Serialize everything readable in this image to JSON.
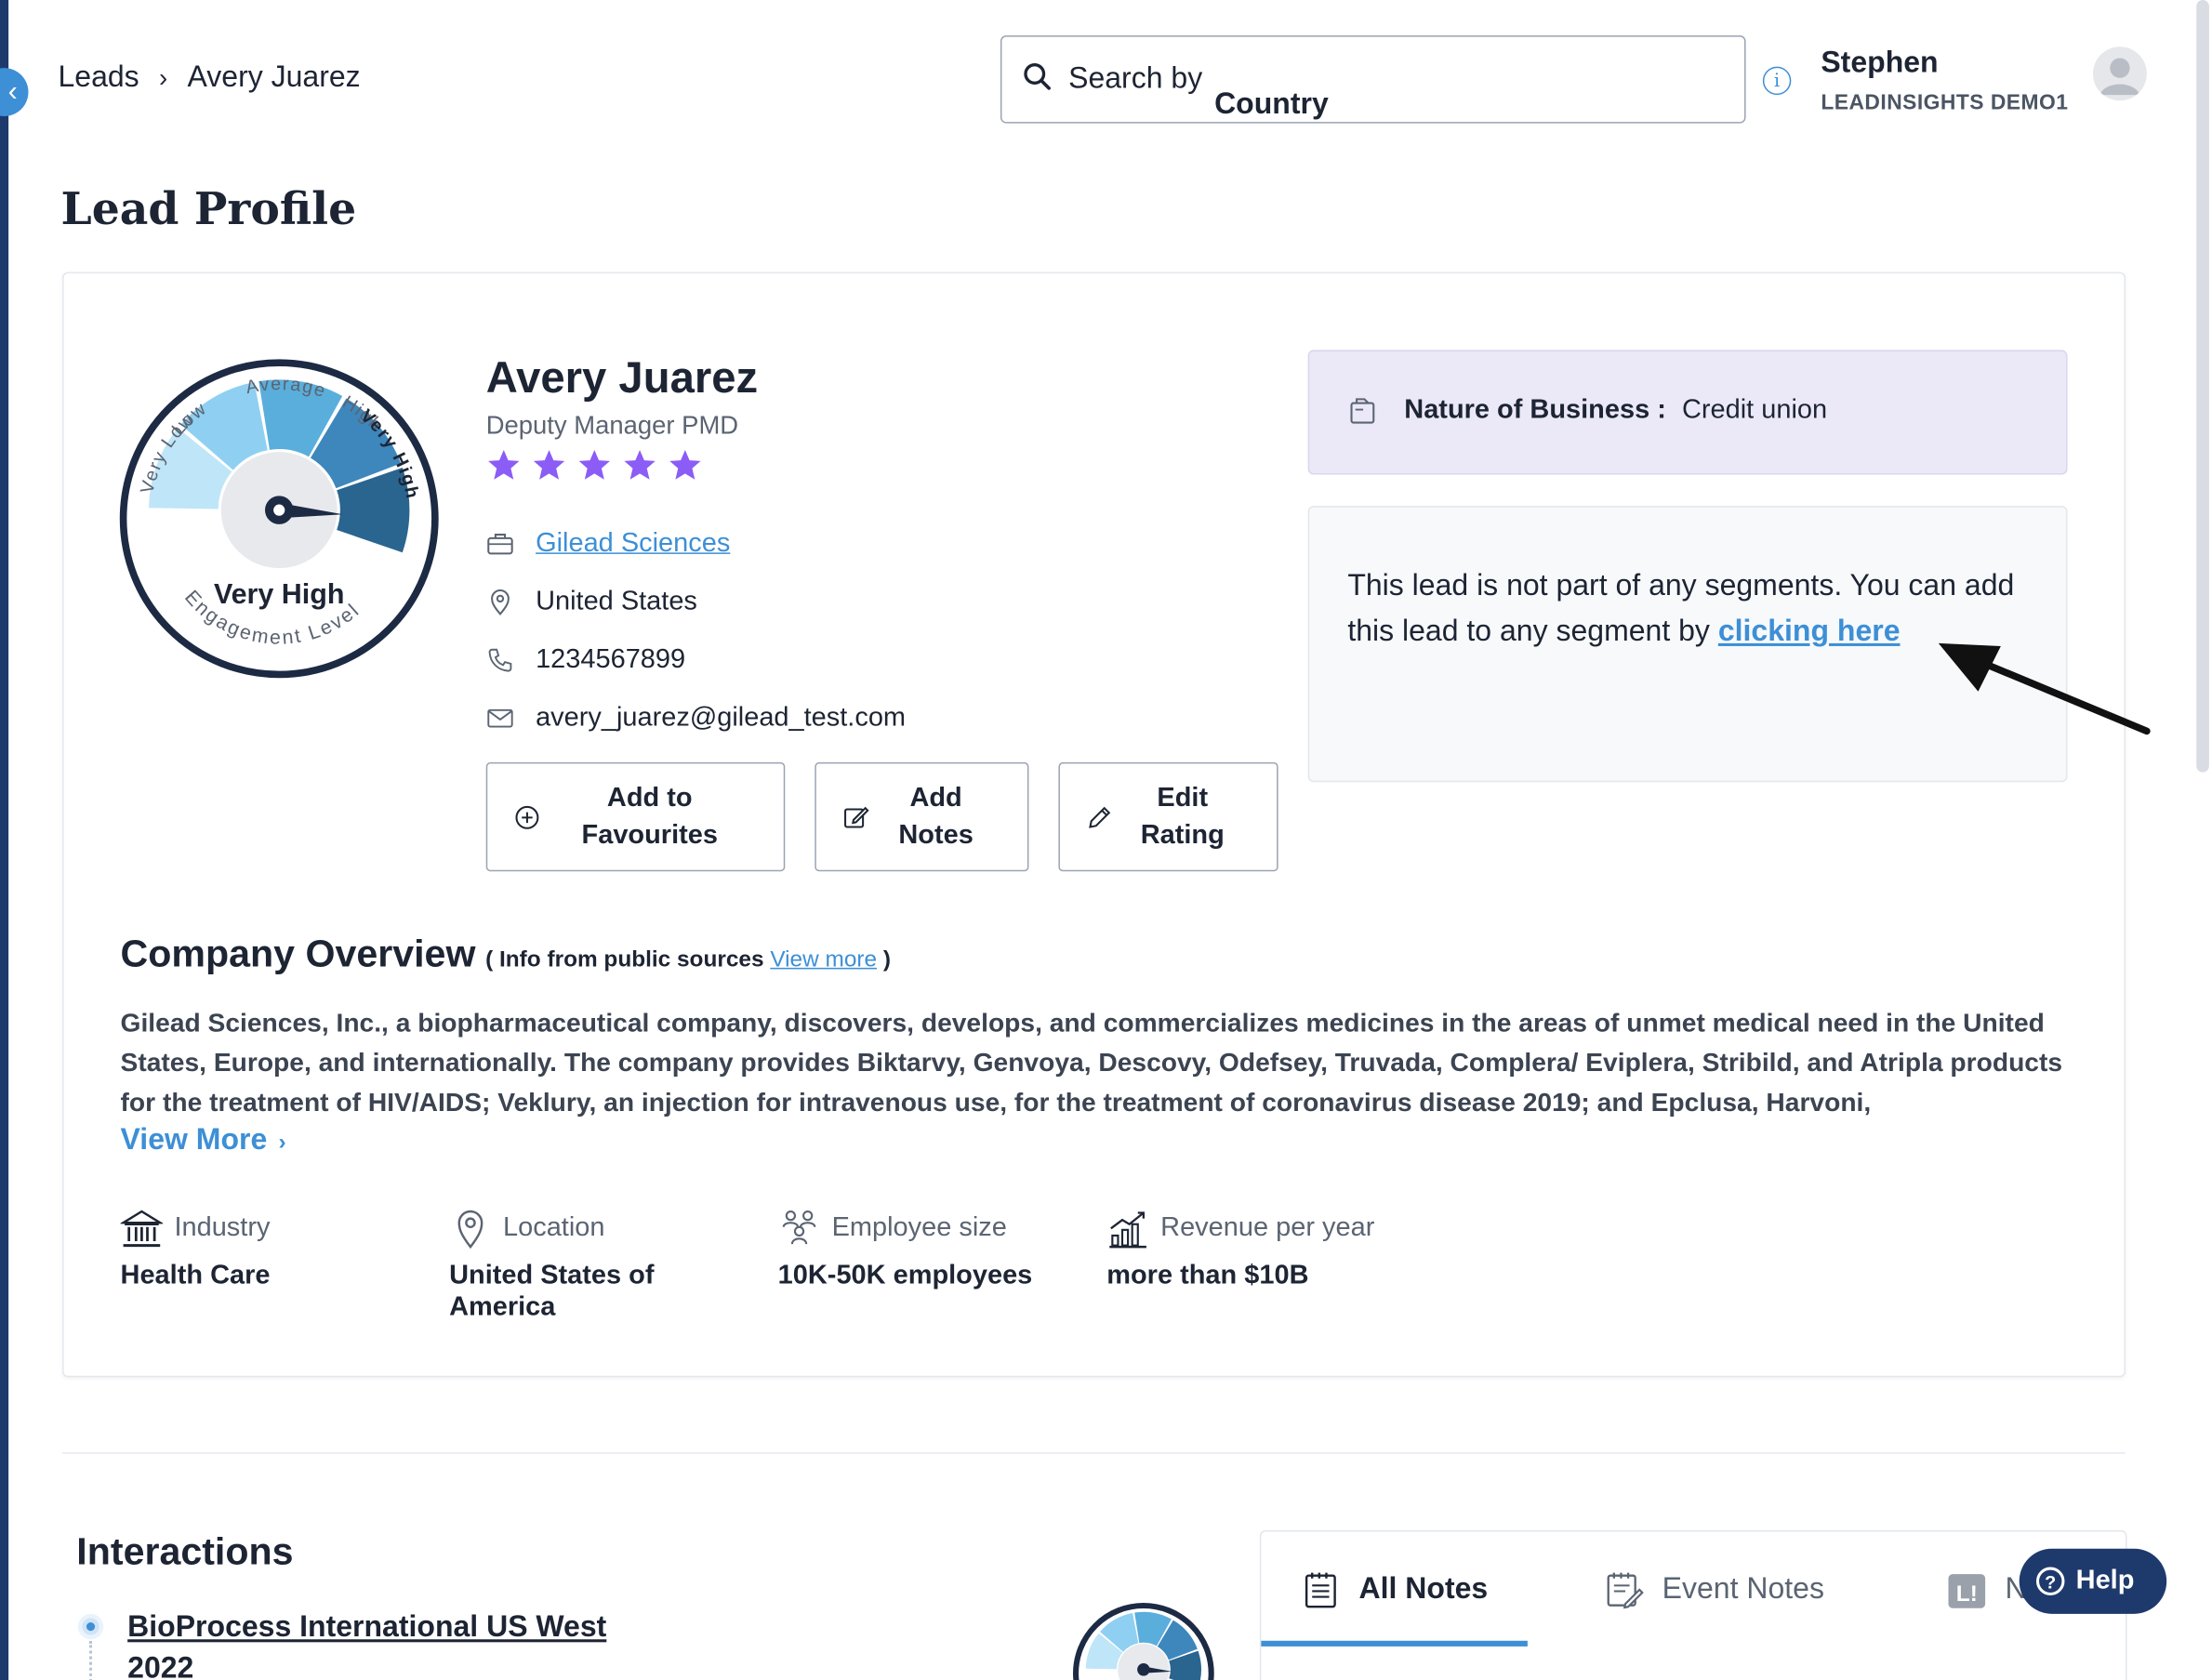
{
  "breadcrumb": {
    "root": "Leads",
    "current": "Avery Juarez"
  },
  "search": {
    "label": "Search by",
    "field": "Country"
  },
  "user": {
    "name": "Stephen",
    "org": "LEADINSIGHTS DEMO1"
  },
  "page": {
    "title": "Lead Profile"
  },
  "gauge": {
    "level_label": "Very High",
    "caption": "Engagement Level",
    "segments": [
      "Very Low",
      "Low",
      "Average",
      "High",
      "Very High"
    ],
    "colors": [
      "#bfe5f8",
      "#8fd0f2",
      "#5aaedc",
      "#3d87bd",
      "#2a6590"
    ]
  },
  "lead": {
    "name": "Avery Juarez",
    "title": "Deputy Manager PMD",
    "rating": 5,
    "company": "Gilead Sciences",
    "location": "United States",
    "phone": "1234567899",
    "email": "avery_juarez@gilead_test.com"
  },
  "actions": {
    "favourites": [
      "Add to",
      "Favourites"
    ],
    "notes": [
      "Add",
      "Notes"
    ],
    "rating": [
      "Edit",
      "Rating"
    ]
  },
  "business": {
    "label": "Nature of Business :",
    "value": "Credit union"
  },
  "segments": {
    "message": "This lead is not part of any segments. You can add this lead to any segment by ",
    "link": "clicking here"
  },
  "company_overview": {
    "title": "Company Overview",
    "sub_prefix": "( Info from public sources",
    "sub_link": "View more",
    "sub_suffix": ")",
    "description": "Gilead Sciences, Inc., a biopharmaceutical company, discovers, develops, and commercializes medicines in the areas of unmet medical need in the United States, Europe, and internationally. The company provides Biktarvy, Genvoya, Descovy, Odefsey, Truvada, Complera/ Eviplera, Stribild, and Atripla products for the treatment of HIV/AIDS; Veklury, an injection for intravenous use, for the treatment of coronavirus disease 2019; and Epclusa, Harvoni,",
    "view_more": "View More",
    "stats": {
      "industry_label": "Industry",
      "industry_value": "Health Care",
      "location_label": "Location",
      "location_value_1": "United States of",
      "location_value_2": "America",
      "employees_label": "Employee size",
      "employees_value": "10K-50K employees",
      "revenue_label": "Revenue per year",
      "revenue_value": "more than $10B"
    }
  },
  "interactions": {
    "title": "Interactions",
    "event_line1": "BioProcess International US West",
    "event_line2": "2022"
  },
  "notes_tabs": {
    "all": "All Notes",
    "event": "Event Notes",
    "third": "N"
  },
  "help": {
    "label": "Help"
  },
  "colors": {
    "accent": "#3d8fd6",
    "navy": "#1e3a6d",
    "star": "#8b5cf6",
    "nob_bg": "#ebe9f7"
  }
}
